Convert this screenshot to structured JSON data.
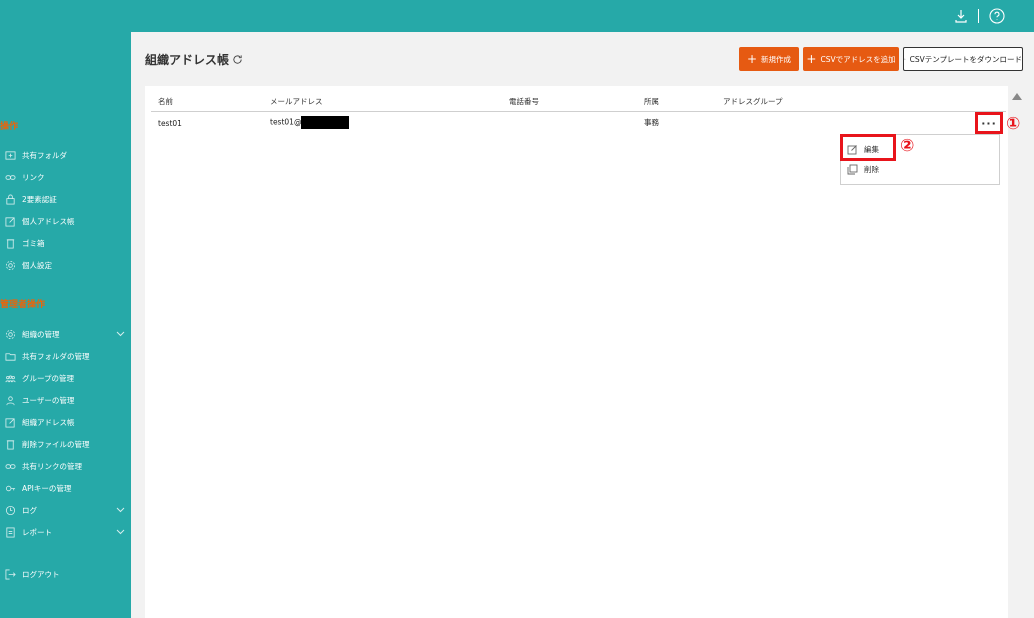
{
  "header": {
    "download_icon": "download-icon",
    "help_icon": "help-icon"
  },
  "sidebar": {
    "section_user": "操作",
    "user_items": [
      {
        "label": "共有フォルダ",
        "icon": "folder-share-icon"
      },
      {
        "label": "リンク",
        "icon": "link-icon"
      },
      {
        "label": "2要素認証",
        "icon": "lock-icon"
      },
      {
        "label": "個人アドレス帳",
        "icon": "edit-icon"
      },
      {
        "label": "ゴミ箱",
        "icon": "trash-icon"
      },
      {
        "label": "個人設定",
        "icon": "gear-icon"
      }
    ],
    "section_admin": "管理者操作",
    "admin_items": [
      {
        "label": "組織の管理",
        "icon": "gear-icon"
      },
      {
        "label": "共有フォルダの管理",
        "icon": "folder-icon"
      },
      {
        "label": "グループの管理",
        "icon": "group-icon"
      },
      {
        "label": "ユーザーの管理",
        "icon": "user-icon"
      },
      {
        "label": "組織アドレス帳",
        "icon": "edit-icon"
      },
      {
        "label": "削除ファイルの管理",
        "icon": "trash-icon"
      },
      {
        "label": "共有リンクの管理",
        "icon": "link-icon"
      },
      {
        "label": "APIキーの管理",
        "icon": "key-icon"
      },
      {
        "label": "ログ",
        "icon": "clock-icon"
      },
      {
        "label": "レポート",
        "icon": "report-icon"
      }
    ],
    "logout": "ログアウト"
  },
  "main": {
    "title": "組織アドレス帳",
    "buttons": {
      "new": "新規作成",
      "csv_add": "CSVでアドレスを追加",
      "csv_template": "CSVテンプレートをダウンロード"
    },
    "columns": [
      "名前",
      "メールアドレス",
      "電話番号",
      "所属",
      "アドレスグループ"
    ],
    "rows": [
      {
        "name": "test01",
        "email": "test01@",
        "phone": "",
        "dept": "事務",
        "group": ""
      }
    ],
    "more": "···",
    "menu": {
      "edit": "編集",
      "delete": "削除"
    },
    "annotations": {
      "step1": "①",
      "step2": "②"
    }
  },
  "colors": {
    "teal": "#26a9a8",
    "orange": "#e65a12",
    "highlight": "#e8141b"
  }
}
